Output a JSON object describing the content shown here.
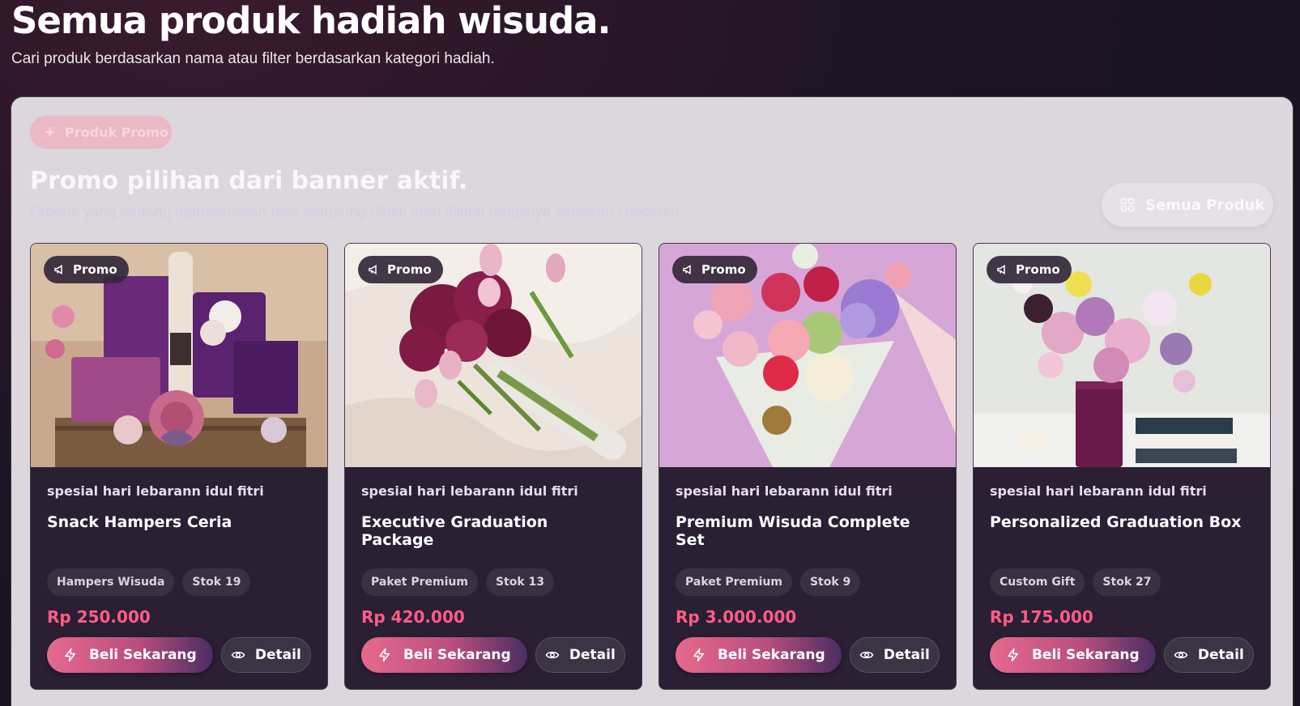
{
  "hero": {
    "title": "Semua produk hadiah wisuda.",
    "subtitle": "Cari produk berdasarkan nama atau filter berdasarkan kategori hadiah."
  },
  "promo_section": {
    "badge_label": "Produk Promo",
    "title": "Promo pilihan dari banner aktif.",
    "subtitle": "Produk yang sedang dipromosikan bisa langsung dibeli atau dilihat detailnya sebelum checkout.",
    "all_products_label": "Semua Produk"
  },
  "cards": [
    {
      "promo_label": "Promo",
      "category": "spesial hari lebarann idul fitri",
      "name": "Snack Hampers Ceria",
      "tag": "Hampers Wisuda",
      "stock": "Stok 19",
      "price": "Rp 250.000",
      "buy_label": "Beli Sekarang",
      "detail_label": "Detail"
    },
    {
      "promo_label": "Promo",
      "category": "spesial hari lebarann idul fitri",
      "name": "Executive Graduation Package",
      "tag": "Paket Premium",
      "stock": "Stok 13",
      "price": "Rp 420.000",
      "buy_label": "Beli Sekarang",
      "detail_label": "Detail"
    },
    {
      "promo_label": "Promo",
      "category": "spesial hari lebarann idul fitri",
      "name": "Premium Wisuda Complete Set",
      "tag": "Paket Premium",
      "stock": "Stok 9",
      "price": "Rp 3.000.000",
      "buy_label": "Beli Sekarang",
      "detail_label": "Detail"
    },
    {
      "promo_label": "Promo",
      "category": "spesial hari lebarann idul fitri",
      "name": "Personalized Graduation Box",
      "tag": "Custom Gift",
      "stock": "Stok 27",
      "price": "Rp 175.000",
      "buy_label": "Beli Sekarang",
      "detail_label": "Detail"
    }
  ],
  "icons": {
    "badge": "sparkle-icon",
    "all_products": "grid-icon",
    "promo": "megaphone-icon",
    "buy": "lightning-icon",
    "detail": "eye-icon"
  },
  "colors": {
    "price": "#ff5d83",
    "buy_gradient_start": "#e6698d",
    "buy_gradient_end": "#4a2d62",
    "card_bg": "#2a1f33",
    "panel_bg": "#dcd6dd"
  }
}
